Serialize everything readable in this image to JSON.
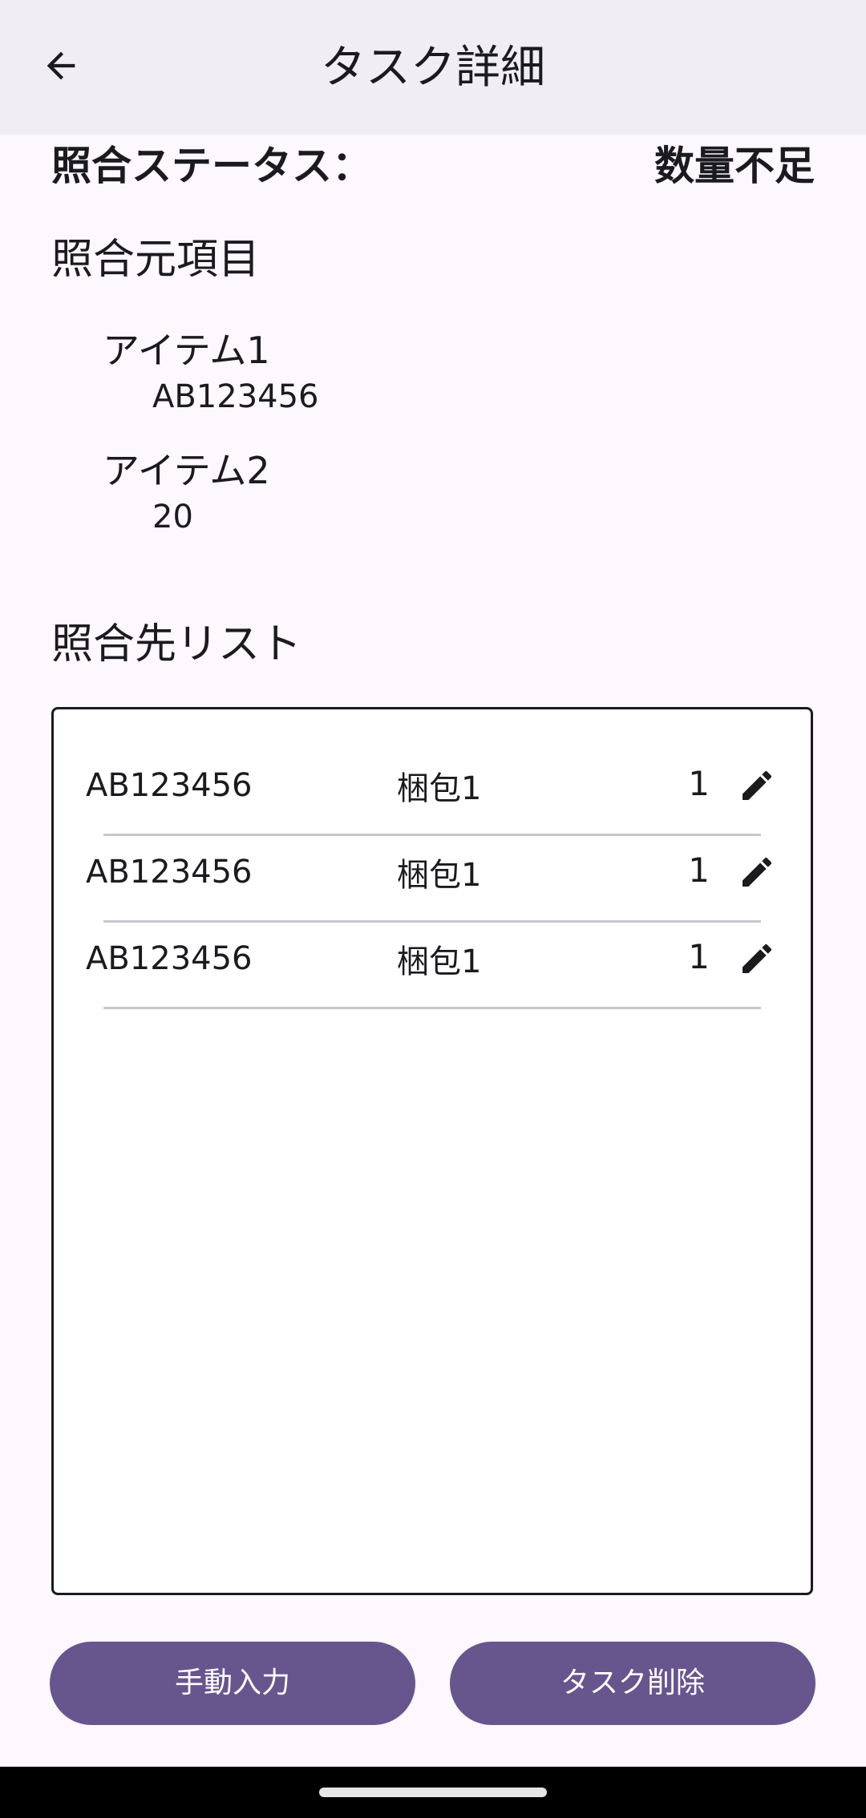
{
  "app_bar": {
    "back_icon": "arrow-left-icon",
    "title": "タスク詳細"
  },
  "status": {
    "label": "照合ステータス：",
    "value": "数量不足"
  },
  "source": {
    "title": "照合元項目",
    "items": [
      {
        "label": "アイテム1",
        "value": "AB123456"
      },
      {
        "label": "アイテム2",
        "value": "20"
      }
    ]
  },
  "destination": {
    "title": "照合先リスト",
    "rows": [
      {
        "code": "AB123456",
        "package": "梱包1",
        "quantity": "1",
        "edit_icon": "pencil-icon"
      },
      {
        "code": "AB123456",
        "package": "梱包1",
        "quantity": "1",
        "edit_icon": "pencil-icon"
      },
      {
        "code": "AB123456",
        "package": "梱包1",
        "quantity": "1",
        "edit_icon": "pencil-icon"
      }
    ]
  },
  "buttons": {
    "manual_input": "手動入力",
    "delete_task": "タスク削除"
  },
  "colors": {
    "primary": "#67558e",
    "app_bar": "#f0eef3",
    "background": "#fdf7fe",
    "divider": "#cac4cf"
  }
}
